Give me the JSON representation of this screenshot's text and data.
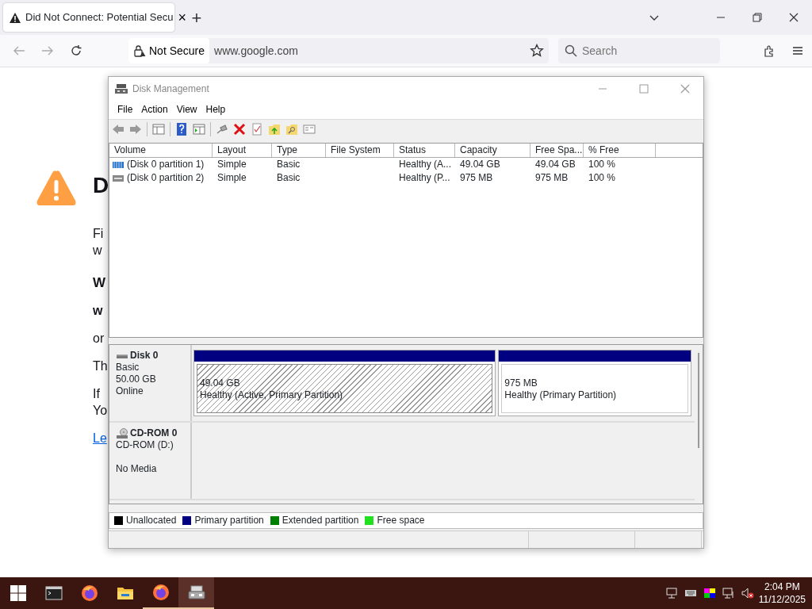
{
  "browser": {
    "tab": {
      "title": "Did Not Connect: Potential Secu",
      "close": "×"
    },
    "new_tab": "+",
    "address": {
      "security": "Not Secure",
      "url": "www.google.com"
    },
    "search": {
      "placeholder": "Search"
    }
  },
  "page": {
    "heading": "D",
    "blocks": [
      {
        "kind": "text",
        "lines": [
          "Fi",
          "w"
        ]
      },
      {
        "kind": "subheading",
        "lines": [
          "W"
        ]
      },
      {
        "kind": "bold",
        "lines": [
          "w"
        ]
      },
      {
        "kind": "text",
        "lines": [
          "or"
        ]
      },
      {
        "kind": "text",
        "lines": [
          "Th"
        ]
      },
      {
        "kind": "text",
        "lines": [
          "If",
          "Yo"
        ]
      },
      {
        "kind": "link",
        "lines": [
          "Le"
        ]
      }
    ]
  },
  "window": {
    "title": "Disk Management",
    "menu": [
      "File",
      "Action",
      "View",
      "Help"
    ],
    "columns": [
      "Volume",
      "Layout",
      "Type",
      "File System",
      "Status",
      "Capacity",
      "Free Spa...",
      "% Free"
    ],
    "volumes": [
      {
        "kind": "primary",
        "volume": "(Disk 0 partition 1)",
        "layout": "Simple",
        "type": "Basic",
        "status": "Healthy (A...",
        "capacity": "49.04 GB",
        "free_space": "49.04 GB",
        "pct_free": "100 %"
      },
      {
        "kind": "plain",
        "volume": "(Disk 0 partition 2)",
        "layout": "Simple",
        "type": "Basic",
        "status": "Healthy (P...",
        "capacity": "975 MB",
        "free_space": "975 MB",
        "pct_free": "100 %"
      }
    ],
    "disks": [
      {
        "kind": "disk",
        "name": "Disk 0",
        "type": "Basic",
        "size": "50.00 GB",
        "status": "Online",
        "partitions": [
          {
            "size": "49.04 GB",
            "status": "Healthy (Active, Primary Partition)",
            "selected": true
          },
          {
            "size": "975 MB",
            "status": "Healthy (Primary Partition)",
            "selected": false
          }
        ]
      },
      {
        "kind": "cdrom",
        "name": "CD-ROM 0",
        "type": "CD-ROM (D:)",
        "status": "No Media"
      }
    ],
    "legend": [
      {
        "label": "Unallocated",
        "color": "#000000"
      },
      {
        "label": "Primary partition",
        "color": "#000080"
      },
      {
        "label": "Extended partition",
        "color": "#008000"
      },
      {
        "label": "Free space",
        "color": "#20e020"
      }
    ]
  },
  "taskbar": {
    "apps": [
      {
        "kind": "terminal",
        "running": false
      },
      {
        "kind": "firefox",
        "running": false
      },
      {
        "kind": "folder",
        "running": false
      },
      {
        "kind": "firefox",
        "running": true
      },
      {
        "kind": "disk",
        "running": true
      }
    ],
    "time": "2:04 PM",
    "date": "11/12/2025"
  }
}
